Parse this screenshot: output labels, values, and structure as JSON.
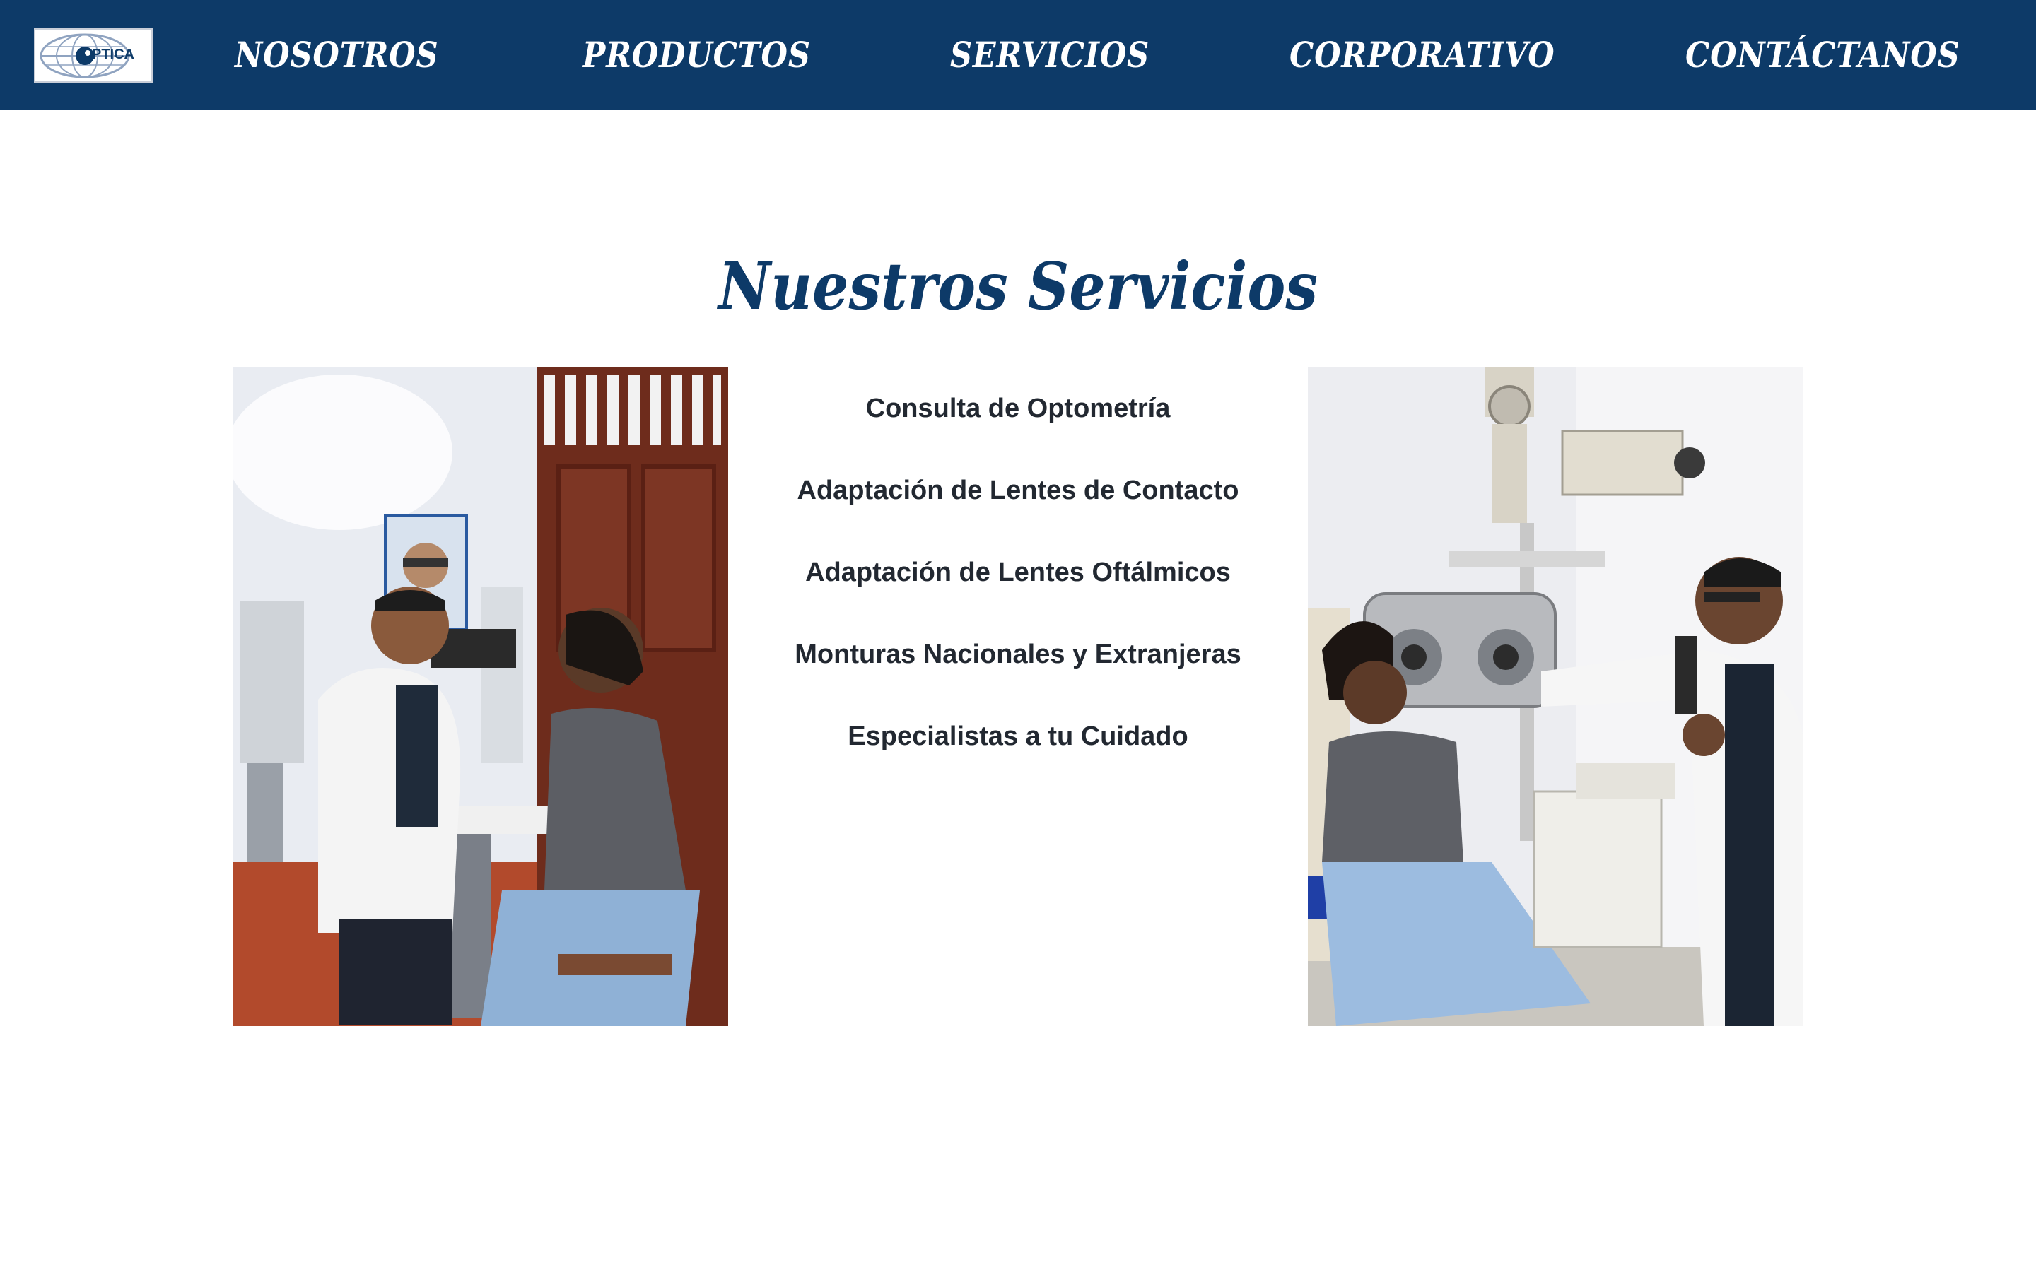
{
  "logo": {
    "text": "PTICA",
    "icon": "eye-globe-logo-icon"
  },
  "nav": {
    "items": [
      {
        "label": "NOSOTROS"
      },
      {
        "label": "PRODUCTOS"
      },
      {
        "label": "SERVICIOS"
      },
      {
        "label": "CORPORATIVO"
      },
      {
        "label": "CONTÁCTANOS"
      }
    ]
  },
  "main": {
    "title": "Nuestros Servicios",
    "services": [
      "Consulta de Optometría",
      "Adaptación de Lentes de Contacto",
      "Adaptación de Lentes Oftálmicos",
      "Monturas Nacionales y Extranjeras",
      "Especialistas a tu Cuidado"
    ],
    "photos": [
      {
        "icon": "slit-lamp-exam-photo"
      },
      {
        "icon": "phoropter-exam-photo"
      }
    ]
  },
  "colors": {
    "navbar": "#0d3a68",
    "title": "#0d3a68",
    "service_text": "#222831",
    "background": "#ffffff"
  }
}
